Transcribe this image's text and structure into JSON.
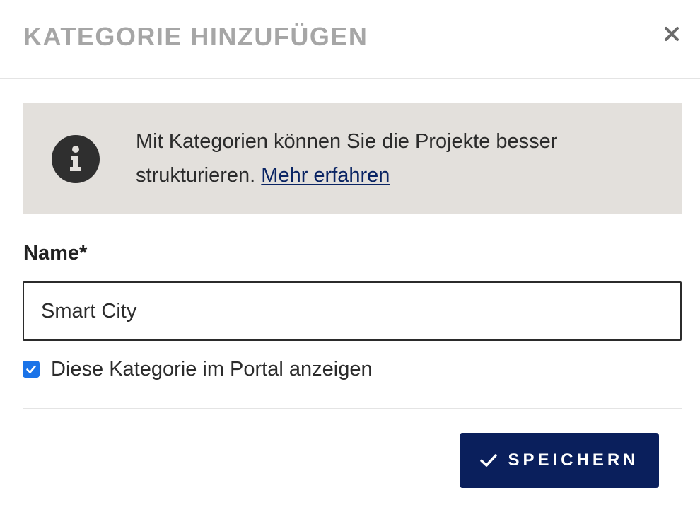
{
  "dialog": {
    "title": "KATEGORIE HINZUFÜGEN",
    "close_icon": "close-icon"
  },
  "info": {
    "icon": "info-icon",
    "text": "Mit Kategorien können Sie die Projekte besser strukturieren.",
    "link_label": "Mehr erfahren"
  },
  "form": {
    "name_label": "Name",
    "required_marker": "*",
    "name_value": "Smart City",
    "show_in_portal_label": "Diese Kategorie im Portal anzeigen",
    "show_in_portal_checked": true
  },
  "actions": {
    "save_label": "SPEICHERN",
    "save_icon": "check-icon"
  },
  "colors": {
    "primary": "#0a1f5c",
    "info_background": "#e3e0dc",
    "link": "#0a2463",
    "checkbox": "#1a73e8",
    "title": "#a6a6a6"
  }
}
